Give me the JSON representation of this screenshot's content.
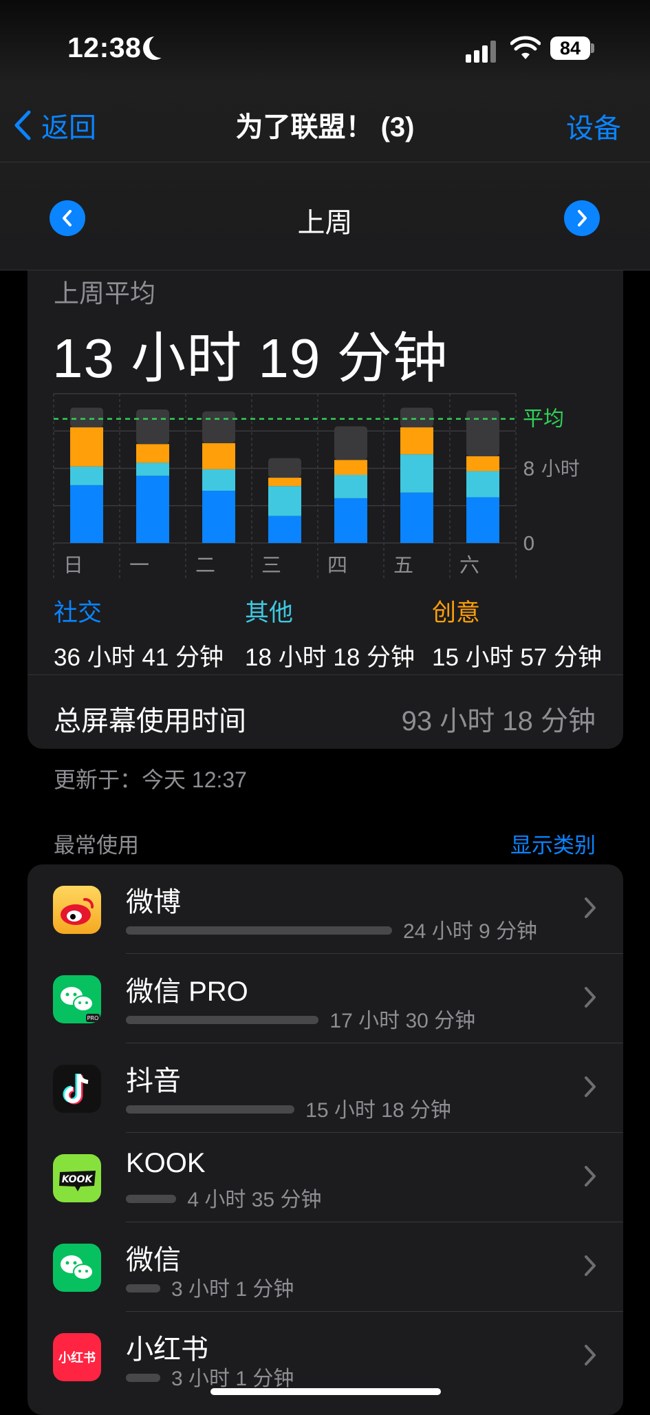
{
  "status": {
    "time": "12:38",
    "battery": "84"
  },
  "nav": {
    "back": "返回",
    "title": "为了联盟！ (3)",
    "right": "设备"
  },
  "week": {
    "label": "上周"
  },
  "summary": {
    "avg_label": "上周平均",
    "avg_value": "13 小时 19 分钟",
    "categories": [
      {
        "name": "社交",
        "time": "36 小时 41 分钟",
        "color": "#0a84ff"
      },
      {
        "name": "其他",
        "time": "18 小时 18 分钟",
        "color": "#40c8e0"
      },
      {
        "name": "创意",
        "time": "15 小时 57 分钟",
        "color": "#ff9f0a"
      }
    ],
    "total_label": "总屏幕使用时间",
    "total_value": "93 小时 18 分钟",
    "updated": "更新于：今天 12:37"
  },
  "chart_data": {
    "type": "bar",
    "stacked": true,
    "categories": [
      "日",
      "一",
      "二",
      "三",
      "四",
      "五",
      "六"
    ],
    "series": [
      {
        "name": "社交",
        "color": "#0a84ff",
        "values": [
          6.2,
          7.2,
          5.6,
          2.9,
          4.8,
          5.4,
          4.9
        ]
      },
      {
        "name": "其他",
        "color": "#40c8e0",
        "values": [
          2.0,
          1.4,
          2.3,
          3.2,
          2.5,
          4.1,
          2.8
        ]
      },
      {
        "name": "创意",
        "color": "#ff9f0a",
        "values": [
          4.2,
          2.0,
          2.8,
          0.9,
          1.6,
          2.9,
          1.6
        ]
      },
      {
        "color": "#3a3a3c",
        "values": [
          2.1,
          3.7,
          3.4,
          2.1,
          3.6,
          2.1,
          4.9
        ]
      }
    ],
    "average": 13.3,
    "average_label": "平均",
    "y_ticks": [
      {
        "value": 8,
        "label": "8 小时"
      },
      {
        "value": 0,
        "label": "0"
      }
    ],
    "ylim": [
      0,
      16
    ]
  },
  "most_used": {
    "label": "最常使用",
    "show_categories": "显示类别"
  },
  "apps": [
    {
      "name": "微博",
      "time": "24 小时 9 分钟",
      "hours": 24.15,
      "icon": "weibo-icon"
    },
    {
      "name": "微信 PRO",
      "time": "17 小时 30 分钟",
      "hours": 17.5,
      "icon": "wechat-pro-icon"
    },
    {
      "name": "抖音",
      "time": "15 小时 18 分钟",
      "hours": 15.3,
      "icon": "douyin-icon"
    },
    {
      "name": "KOOK",
      "time": "4 小时 35 分钟",
      "hours": 4.58,
      "icon": "kook-icon"
    },
    {
      "name": "微信",
      "time": "3 小时 1 分钟",
      "hours": 3.02,
      "icon": "wechat-icon"
    },
    {
      "name": "小红书",
      "time": "3 小时 1 分钟",
      "hours": 3.02,
      "icon": "xiaohongshu-icon"
    }
  ],
  "icon_text": {
    "kook": "KOOK",
    "xhs": "小红书",
    "pro": "PRO"
  }
}
